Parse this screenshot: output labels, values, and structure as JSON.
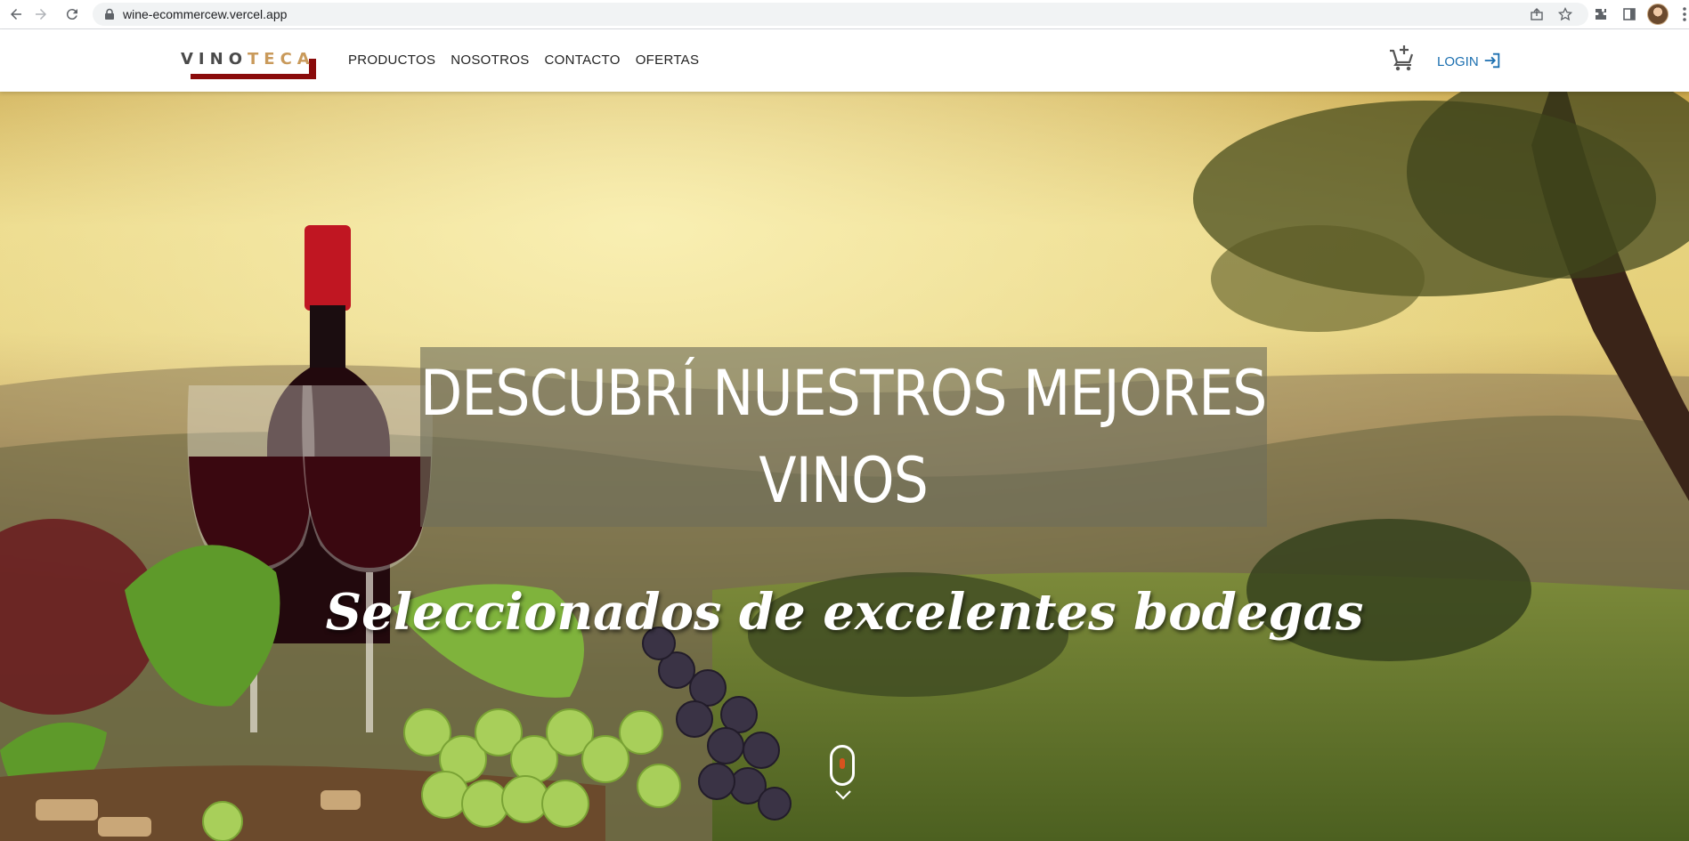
{
  "browser": {
    "url": "wine-ecommercew.vercel.app",
    "icons": [
      "back-arrow-icon",
      "forward-arrow-icon",
      "reload-icon",
      "lock-icon",
      "share-icon",
      "star-icon",
      "extensions-icon",
      "side-panel-icon",
      "avatar",
      "more-icon"
    ]
  },
  "header": {
    "logo": {
      "part1": "VINO",
      "part2": "TECA",
      "accent_color": "#c99a5b",
      "bar_color": "#8a0b0b"
    },
    "menu": [
      {
        "label": "PRODUCTOS"
      },
      {
        "label": "NOSOTROS"
      },
      {
        "label": "CONTACTO"
      },
      {
        "label": "OFERTAS"
      }
    ],
    "cart_icon": "cart-add-icon",
    "login_label": "LOGIN",
    "login_color": "#1b6fb0"
  },
  "hero": {
    "title_line1": "DESCUBRÍ NUESTROS MEJORES",
    "title_line2": "VINOS",
    "subtitle": "Seleccionados de excelentes bodegas",
    "scroll_indicator": "mouse-scroll-icon"
  }
}
